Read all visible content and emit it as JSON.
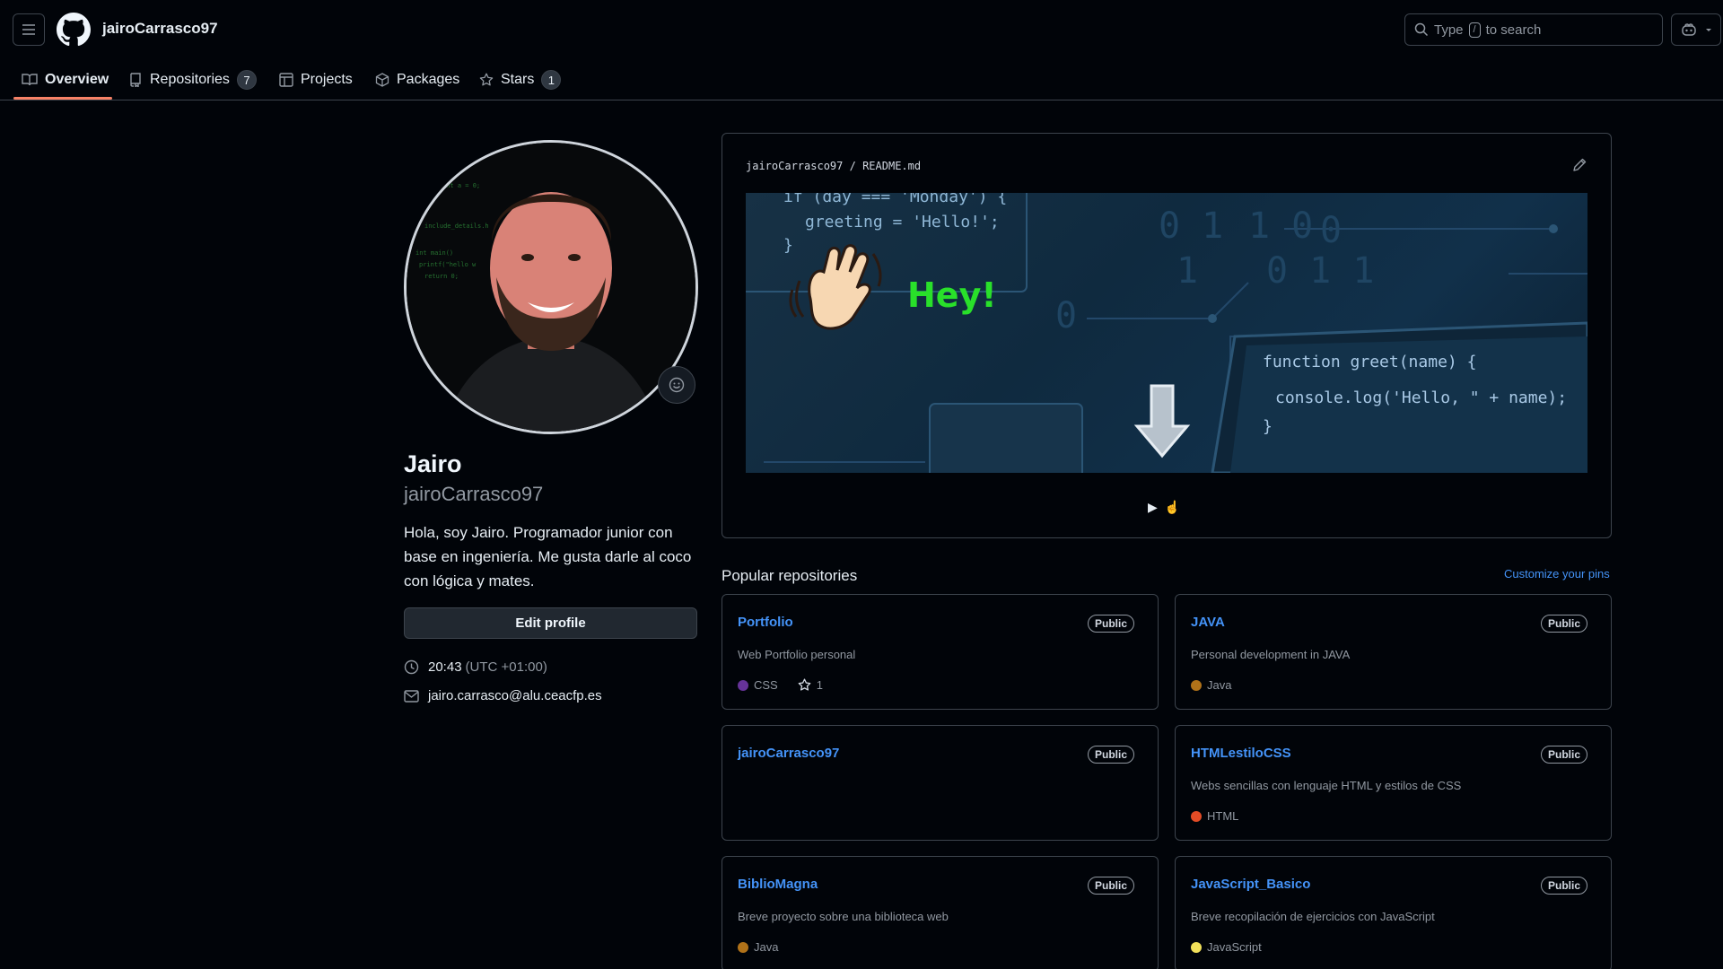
{
  "header": {
    "username": "jairoCarrasco97",
    "search": {
      "pre": "Type",
      "key": "/",
      "post": "to search"
    }
  },
  "tabs": [
    {
      "label": "Overview"
    },
    {
      "label": "Repositories",
      "count": "7"
    },
    {
      "label": "Projects"
    },
    {
      "label": "Packages"
    },
    {
      "label": "Stars",
      "count": "1"
    }
  ],
  "profile": {
    "name": "Jairo",
    "login": "jairoCarrasco97",
    "bio": "Hola, soy Jairo. Programador junior con base en ingeniería. Me gusta darle al coco con lógica y mates.",
    "edit_label": "Edit profile",
    "time": "20:43",
    "timezone": "(UTC +01:00)",
    "email": "jairo.carrasco@alu.ceacfp.es"
  },
  "readme": {
    "owner": "jairoCarrasco97",
    "separator": "/",
    "file": "README.md",
    "banner": {
      "code_top_1": "if (day === 'Monday') {",
      "code_top_2": "greeting = 'Hello!';",
      "code_top_3": "}",
      "hey": "Hey!",
      "code_bottom_1": "function greet(name) {",
      "code_bottom_2": "console.log('Hello, \" + name);",
      "code_bottom_3": "}"
    },
    "play_symbol": "▶",
    "play_emoji": "☝"
  },
  "popular": {
    "title": "Popular repositories",
    "customize": "Customize your pins",
    "repos": [
      {
        "name": "Portfolio",
        "visibility": "Public",
        "description": "Web Portfolio personal",
        "language": "CSS",
        "lang_color": "#663399",
        "stars": "1"
      },
      {
        "name": "JAVA",
        "visibility": "Public",
        "description": "Personal development in JAVA",
        "language": "Java",
        "lang_color": "#b07219",
        "stars": ""
      },
      {
        "name": "jairoCarrasco97",
        "visibility": "Public",
        "description": "",
        "language": "",
        "lang_color": "",
        "stars": ""
      },
      {
        "name": "HTMLestiloCSS",
        "visibility": "Public",
        "description": "Webs sencillas con lenguaje HTML y estilos de CSS",
        "language": "HTML",
        "lang_color": "#e34c26",
        "stars": ""
      },
      {
        "name": "BiblioMagna",
        "visibility": "Public",
        "description": "Breve proyecto sobre una biblioteca web",
        "language": "Java",
        "lang_color": "#b07219",
        "stars": ""
      },
      {
        "name": "JavaScript_Basico",
        "visibility": "Public",
        "description": "Breve recopilación de ejercicios con JavaScript",
        "language": "JavaScript",
        "lang_color": "#f1e05a",
        "stars": ""
      }
    ]
  }
}
